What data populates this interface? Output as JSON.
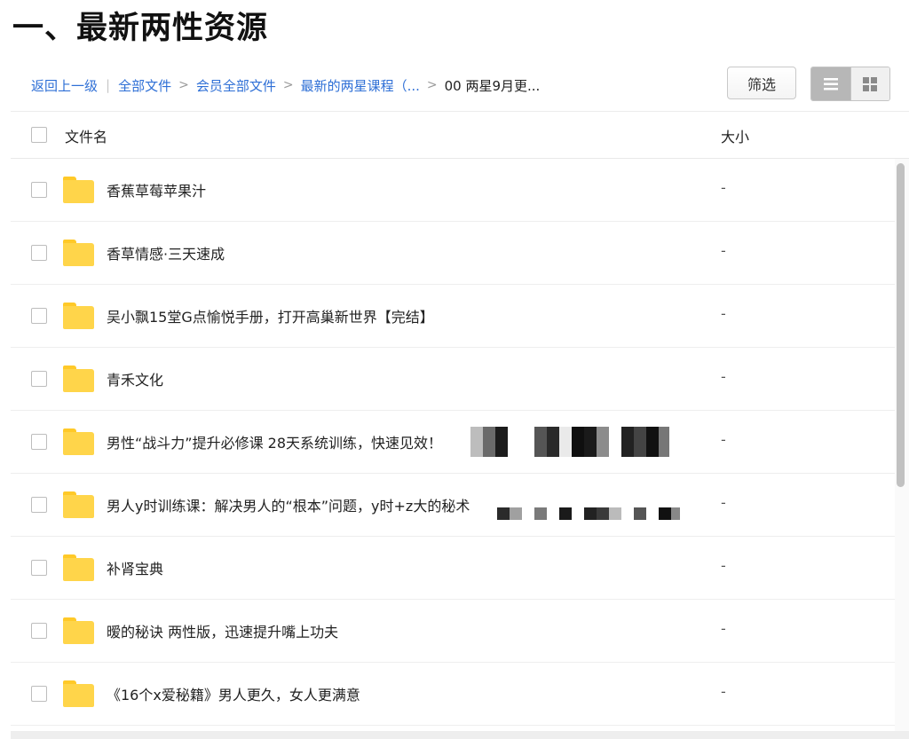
{
  "page_title": "一、最新两性资源",
  "breadcrumb": {
    "back": "返回上一级",
    "sep_bar": "|",
    "sep_arrow": ">",
    "crumb_1": "全部文件",
    "crumb_2": "会员全部文件",
    "crumb_3": "最新的两星课程（...",
    "crumb_4": "00 两星9月更..."
  },
  "toolbar": {
    "filter_label": "筛选",
    "list_view_icon": "list-view-icon",
    "grid_view_icon": "grid-view-icon",
    "active_view": "list"
  },
  "table": {
    "col_name": "文件名",
    "col_size": "大小"
  },
  "files": [
    {
      "name": "香蕉草莓苹果汁",
      "size": "-",
      "icon": "folder-icon"
    },
    {
      "name": "香草情感·三天速成",
      "size": "-",
      "icon": "folder-icon"
    },
    {
      "name": "吴小飘15堂G点愉悦手册，打开高巢新世界【完结】",
      "size": "-",
      "icon": "folder-icon"
    },
    {
      "name": "青禾文化",
      "size": "-",
      "icon": "folder-icon"
    },
    {
      "name": "男性“战斗力”提升必修课 28天系统训练，快速见效！",
      "size": "-",
      "icon": "folder-icon",
      "redacted": true
    },
    {
      "name": "男人y时训练课：解决男人的“根本”问题，y时+z大的秘术",
      "size": "-",
      "icon": "folder-icon",
      "redacted": true
    },
    {
      "name": "补肾宝典",
      "size": "-",
      "icon": "folder-icon"
    },
    {
      "name": "暧的秘诀 两性版，迅速提升嘴上功夫",
      "size": "-",
      "icon": "folder-icon"
    },
    {
      "name": "《16个x爱秘籍》男人更久，女人更满意",
      "size": "-",
      "icon": "folder-icon"
    }
  ],
  "colors": {
    "link": "#2e6fd6",
    "folder": "#ffd54a",
    "active_view_bg": "#b7b7b7"
  }
}
